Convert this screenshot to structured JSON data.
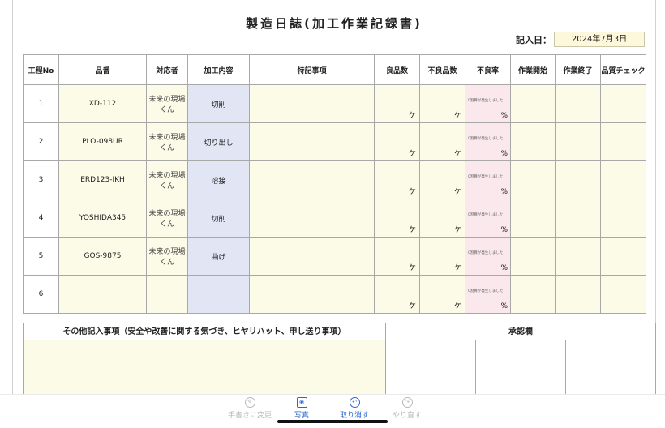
{
  "sheet": {
    "title": "製造日誌(加工作業記録書)",
    "date_label": "記入日：",
    "date_value": "2024年7月3日"
  },
  "table": {
    "headers": [
      "工程No",
      "品番",
      "対応者",
      "加工内容",
      "特記事項",
      "良品数",
      "不良品数",
      "不良率",
      "作業開始",
      "作業終了",
      "品質チェック"
    ],
    "unit_label": "ケ",
    "pct_label": "%",
    "note_text": "0割算が発生しました",
    "rows": [
      {
        "no": "1",
        "part": "XD-112",
        "person": "未来の現場くん",
        "process": "切削"
      },
      {
        "no": "2",
        "part": "PLO-098UR",
        "person": "未来の現場くん",
        "process": "切り出し"
      },
      {
        "no": "3",
        "part": "ERD123-IKH",
        "person": "未来の現場くん",
        "process": "溶接"
      },
      {
        "no": "4",
        "part": "YOSHIDA345",
        "person": "未来の現場くん",
        "process": "切削"
      },
      {
        "no": "5",
        "part": "GOS-9875",
        "person": "未来の現場くん",
        "process": "曲げ"
      },
      {
        "no": "6",
        "part": "",
        "person": "",
        "process": ""
      }
    ]
  },
  "bottom": {
    "notes_header": "その他記入事項（安全や改善に関する気づき、ヒヤリハット、申し送り事項）",
    "approval_header": "承認欄"
  },
  "toolbar": {
    "items": [
      {
        "label": "手書きに変更",
        "icon": "handwriting-icon"
      },
      {
        "label": "写真",
        "icon": "camera-icon"
      },
      {
        "label": "取り消す",
        "icon": "undo-icon"
      },
      {
        "label": "やり直す",
        "icon": "redo-icon"
      }
    ]
  },
  "colors": {
    "input_yellow": "#fbfbe8",
    "process_blue": "#e2e6f4",
    "rate_pink": "#fbe8ec",
    "toolbar_active": "#2a66d0"
  }
}
